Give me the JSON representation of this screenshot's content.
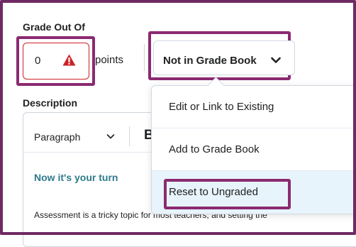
{
  "grade": {
    "label": "Grade Out Of",
    "value": "0",
    "points_label": "points",
    "warning_icon": "warning-icon"
  },
  "grade_book": {
    "button_label": "Not in Grade Book",
    "chevron_icon": "chevron-down-icon"
  },
  "description": {
    "label": "Description",
    "toolbar": {
      "format_select": "Paragraph",
      "bold_label": "B"
    },
    "heading": "Now it's your turn",
    "body": "Assessment is a tricky topic for most teachers, and setting the"
  },
  "menu": {
    "items": [
      {
        "label": "Edit or Link to Existing"
      },
      {
        "label": "Add to Grade Book"
      },
      {
        "label": "Reset to Ungraded"
      }
    ]
  },
  "colors": {
    "highlight_border": "#8b2a72",
    "error_red": "#cd2026",
    "heading_teal": "#2e7a8a",
    "menu_hover": "#e8f4fb"
  }
}
